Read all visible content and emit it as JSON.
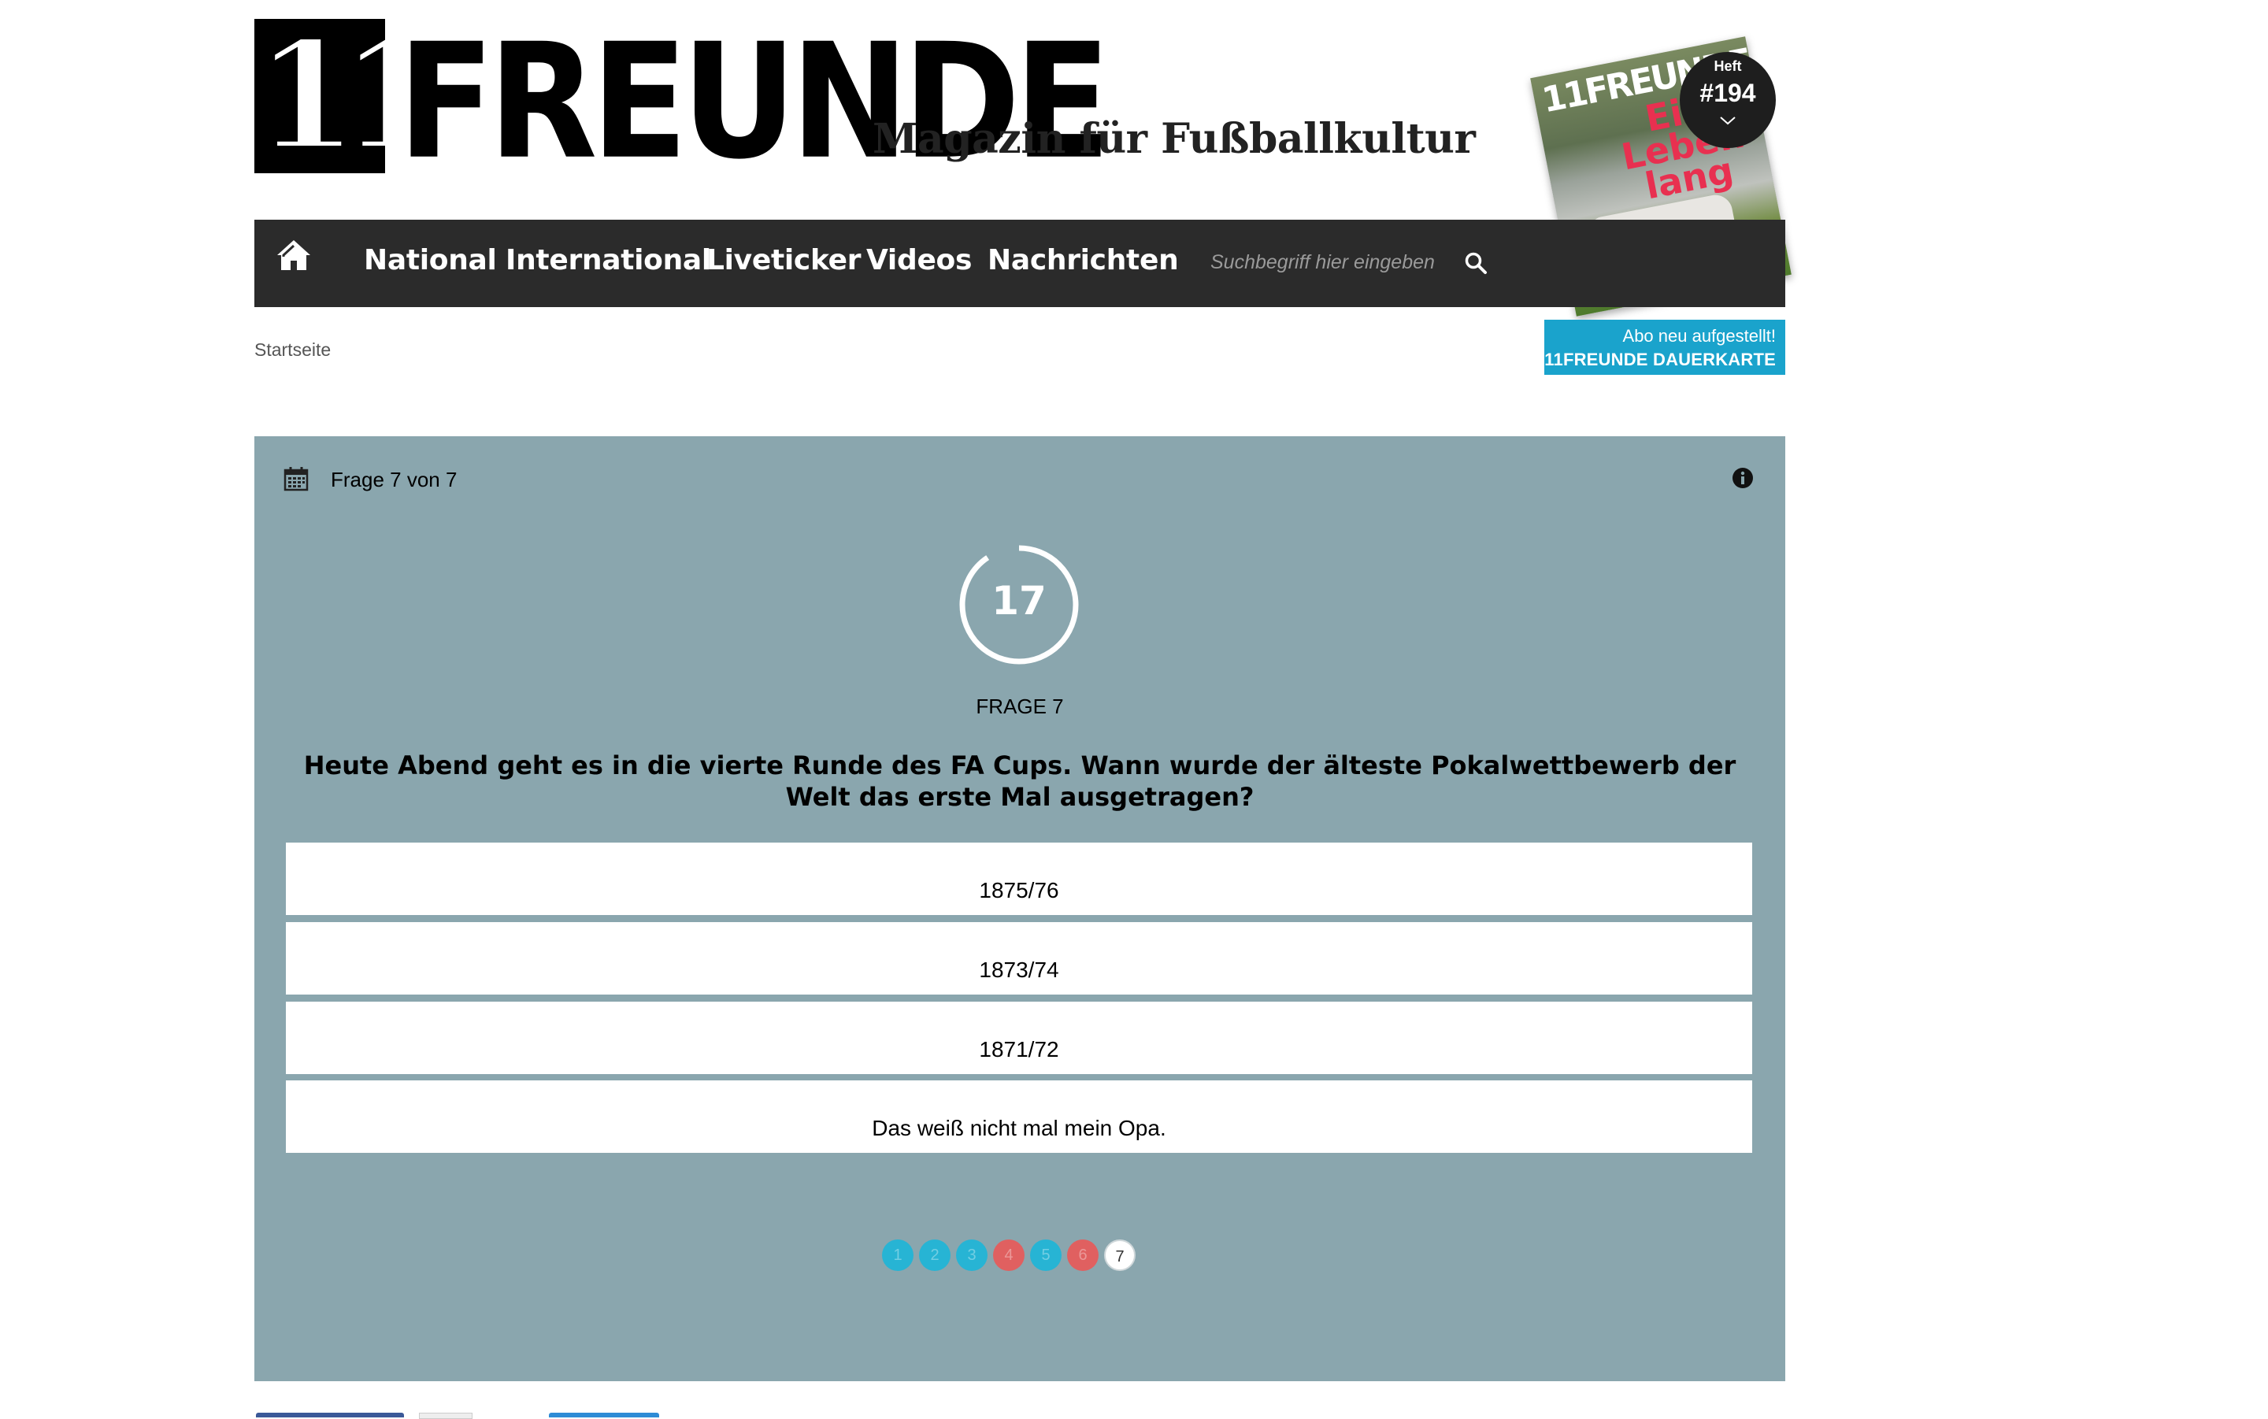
{
  "header": {
    "logo_number": "11",
    "logo_word": "FREUNDE",
    "tagline": "Magazin für Fußballkultur"
  },
  "nav": {
    "items": [
      "National",
      "International",
      "Liveticker",
      "Videos",
      "Nachrichten"
    ],
    "search_placeholder": "Suchbegriff hier eingeben"
  },
  "magazine": {
    "cover_brand": "11FREUNDE",
    "cover_headline": "Ein Leben lang",
    "issue_label": "Heft",
    "issue_number": "#194"
  },
  "breadcrumb": {
    "home": "Startseite"
  },
  "abo": {
    "line1": "Abo neu aufgestellt!",
    "line2": "11FREUNDE DAUERKARTE"
  },
  "quiz": {
    "progress": "Frage 7 von 7",
    "timer": "17",
    "question_label": "FRAGE 7",
    "question": "Heute Abend geht es in die vierte Runde des FA Cups. Wann wurde der älteste Pokalwettbewerb der Welt das erste Mal ausgetragen?",
    "answers": [
      "1875/76",
      "1873/74",
      "1871/72",
      "Das weiß nicht mal mein Opa."
    ],
    "dots": [
      {
        "label": "1",
        "status": "done"
      },
      {
        "label": "2",
        "status": "done"
      },
      {
        "label": "3",
        "status": "done"
      },
      {
        "label": "4",
        "status": "wrong"
      },
      {
        "label": "5",
        "status": "done"
      },
      {
        "label": "6",
        "status": "wrong"
      },
      {
        "label": "7",
        "status": "current"
      }
    ]
  },
  "colors": {
    "nav_bg": "#2b2b2b",
    "quiz_bg": "#8aa6ae",
    "accent": "#1aa3cc",
    "dot_done": "#27b4d4",
    "dot_wrong": "#e06060"
  }
}
